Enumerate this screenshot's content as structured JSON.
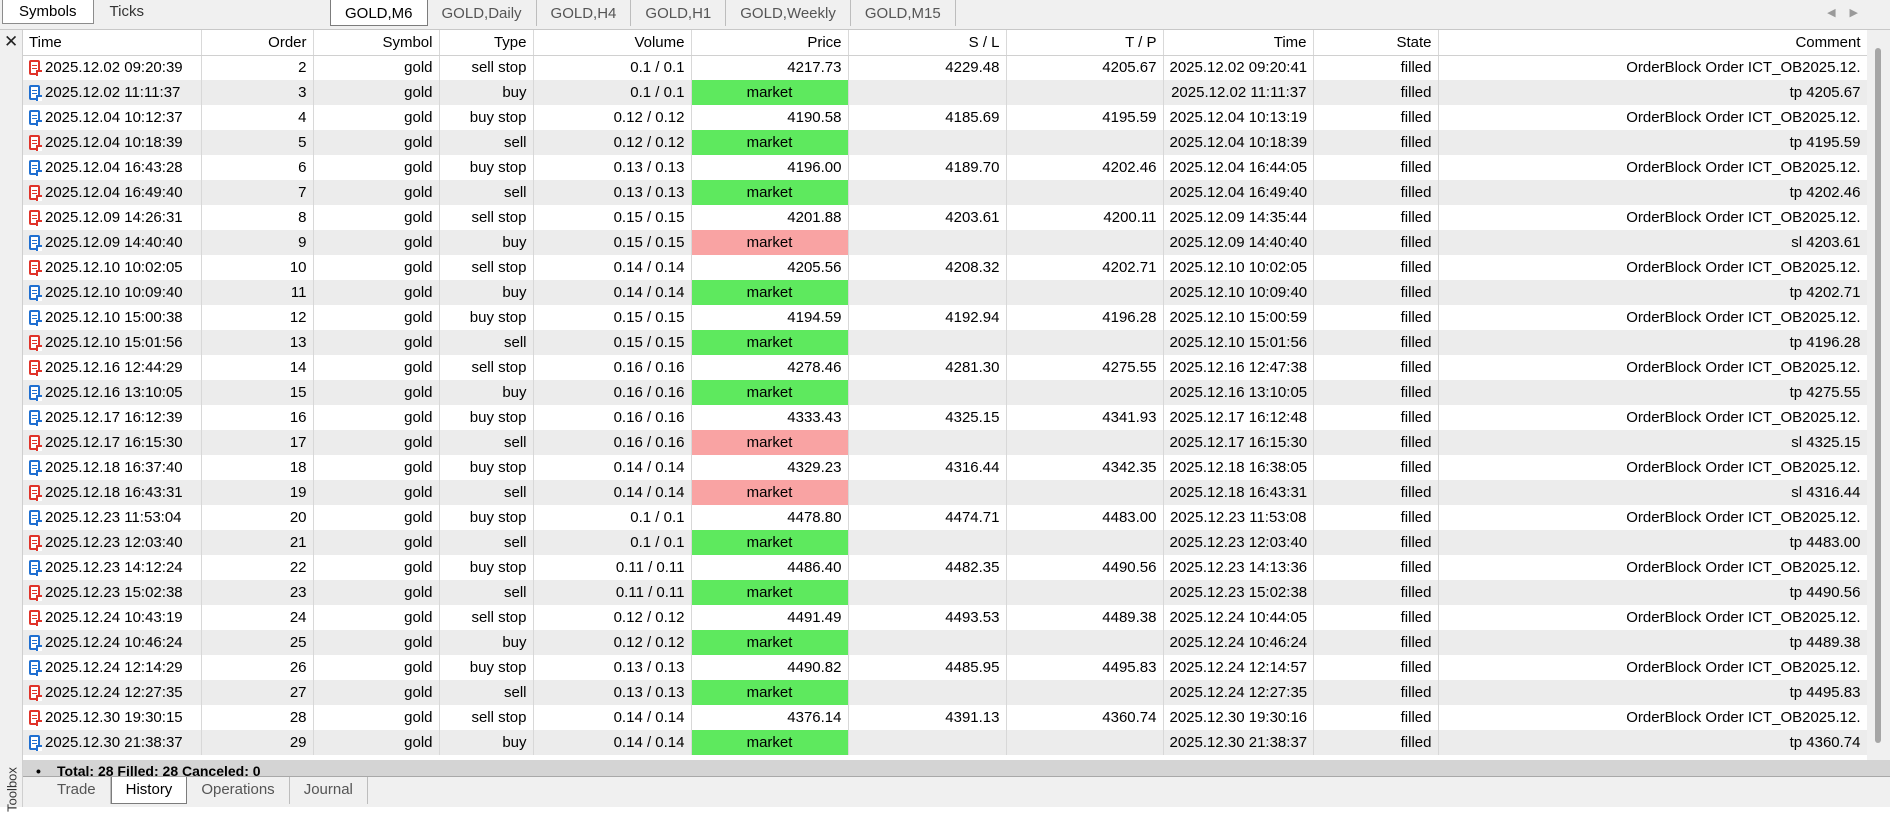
{
  "symbol_tabs": [
    {
      "label": "Symbols",
      "active": true
    },
    {
      "label": "Ticks",
      "active": false
    }
  ],
  "chart_tabs": [
    {
      "label": "GOLD,M6",
      "active": true
    },
    {
      "label": "GOLD,Daily",
      "active": false
    },
    {
      "label": "GOLD,H4",
      "active": false
    },
    {
      "label": "GOLD,H1",
      "active": false
    },
    {
      "label": "GOLD,Weekly",
      "active": false
    },
    {
      "label": "GOLD,M15",
      "active": false
    }
  ],
  "toolbox_label": "Toolbox",
  "columns": [
    "Time",
    "Order",
    "Symbol",
    "Type",
    "Volume",
    "Price",
    "S / L",
    "T / P",
    "Time",
    "State",
    "Comment"
  ],
  "colors": {
    "market_profit": "#5ee95e",
    "market_loss": "#f9a3a3",
    "sell_icon": "#e0332a",
    "buy_icon": "#1f6fd1"
  },
  "orders": [
    {
      "dir": "sell",
      "time": "2025.12.02 09:20:39",
      "order": "2",
      "symbol": "gold",
      "type": "sell stop",
      "volume": "0.1 / 0.1",
      "price": "4217.73",
      "sl": "4229.48",
      "tp": "4205.67",
      "time2": "2025.12.02 09:20:41",
      "state": "filled",
      "comment": "OrderBlock Order ICT_OB2025.12.",
      "mk": ""
    },
    {
      "dir": "buy",
      "time": "2025.12.02 11:11:37",
      "order": "3",
      "symbol": "gold",
      "type": "buy",
      "volume": "0.1 / 0.1",
      "price": "market",
      "sl": "",
      "tp": "",
      "time2": "2025.12.02 11:11:37",
      "state": "filled",
      "comment": "tp 4205.67",
      "mk": "green"
    },
    {
      "dir": "buy",
      "time": "2025.12.04 10:12:37",
      "order": "4",
      "symbol": "gold",
      "type": "buy stop",
      "volume": "0.12 / 0.12",
      "price": "4190.58",
      "sl": "4185.69",
      "tp": "4195.59",
      "time2": "2025.12.04 10:13:19",
      "state": "filled",
      "comment": "OrderBlock Order ICT_OB2025.12.",
      "mk": ""
    },
    {
      "dir": "sell",
      "time": "2025.12.04 10:18:39",
      "order": "5",
      "symbol": "gold",
      "type": "sell",
      "volume": "0.12 / 0.12",
      "price": "market",
      "sl": "",
      "tp": "",
      "time2": "2025.12.04 10:18:39",
      "state": "filled",
      "comment": "tp 4195.59",
      "mk": "green"
    },
    {
      "dir": "buy",
      "time": "2025.12.04 16:43:28",
      "order": "6",
      "symbol": "gold",
      "type": "buy stop",
      "volume": "0.13 / 0.13",
      "price": "4196.00",
      "sl": "4189.70",
      "tp": "4202.46",
      "time2": "2025.12.04 16:44:05",
      "state": "filled",
      "comment": "OrderBlock Order ICT_OB2025.12.",
      "mk": ""
    },
    {
      "dir": "sell",
      "time": "2025.12.04 16:49:40",
      "order": "7",
      "symbol": "gold",
      "type": "sell",
      "volume": "0.13 / 0.13",
      "price": "market",
      "sl": "",
      "tp": "",
      "time2": "2025.12.04 16:49:40",
      "state": "filled",
      "comment": "tp 4202.46",
      "mk": "green"
    },
    {
      "dir": "sell",
      "time": "2025.12.09 14:26:31",
      "order": "8",
      "symbol": "gold",
      "type": "sell stop",
      "volume": "0.15 / 0.15",
      "price": "4201.88",
      "sl": "4203.61",
      "tp": "4200.11",
      "time2": "2025.12.09 14:35:44",
      "state": "filled",
      "comment": "OrderBlock Order ICT_OB2025.12.",
      "mk": ""
    },
    {
      "dir": "buy",
      "time": "2025.12.09 14:40:40",
      "order": "9",
      "symbol": "gold",
      "type": "buy",
      "volume": "0.15 / 0.15",
      "price": "market",
      "sl": "",
      "tp": "",
      "time2": "2025.12.09 14:40:40",
      "state": "filled",
      "comment": "sl 4203.61",
      "mk": "red"
    },
    {
      "dir": "sell",
      "time": "2025.12.10 10:02:05",
      "order": "10",
      "symbol": "gold",
      "type": "sell stop",
      "volume": "0.14 / 0.14",
      "price": "4205.56",
      "sl": "4208.32",
      "tp": "4202.71",
      "time2": "2025.12.10 10:02:05",
      "state": "filled",
      "comment": "OrderBlock Order ICT_OB2025.12.",
      "mk": ""
    },
    {
      "dir": "buy",
      "time": "2025.12.10 10:09:40",
      "order": "11",
      "symbol": "gold",
      "type": "buy",
      "volume": "0.14 / 0.14",
      "price": "market",
      "sl": "",
      "tp": "",
      "time2": "2025.12.10 10:09:40",
      "state": "filled",
      "comment": "tp 4202.71",
      "mk": "green"
    },
    {
      "dir": "buy",
      "time": "2025.12.10 15:00:38",
      "order": "12",
      "symbol": "gold",
      "type": "buy stop",
      "volume": "0.15 / 0.15",
      "price": "4194.59",
      "sl": "4192.94",
      "tp": "4196.28",
      "time2": "2025.12.10 15:00:59",
      "state": "filled",
      "comment": "OrderBlock Order ICT_OB2025.12.",
      "mk": ""
    },
    {
      "dir": "sell",
      "time": "2025.12.10 15:01:56",
      "order": "13",
      "symbol": "gold",
      "type": "sell",
      "volume": "0.15 / 0.15",
      "price": "market",
      "sl": "",
      "tp": "",
      "time2": "2025.12.10 15:01:56",
      "state": "filled",
      "comment": "tp 4196.28",
      "mk": "green"
    },
    {
      "dir": "sell",
      "time": "2025.12.16 12:44:29",
      "order": "14",
      "symbol": "gold",
      "type": "sell stop",
      "volume": "0.16 / 0.16",
      "price": "4278.46",
      "sl": "4281.30",
      "tp": "4275.55",
      "time2": "2025.12.16 12:47:38",
      "state": "filled",
      "comment": "OrderBlock Order ICT_OB2025.12.",
      "mk": ""
    },
    {
      "dir": "buy",
      "time": "2025.12.16 13:10:05",
      "order": "15",
      "symbol": "gold",
      "type": "buy",
      "volume": "0.16 / 0.16",
      "price": "market",
      "sl": "",
      "tp": "",
      "time2": "2025.12.16 13:10:05",
      "state": "filled",
      "comment": "tp 4275.55",
      "mk": "green"
    },
    {
      "dir": "buy",
      "time": "2025.12.17 16:12:39",
      "order": "16",
      "symbol": "gold",
      "type": "buy stop",
      "volume": "0.16 / 0.16",
      "price": "4333.43",
      "sl": "4325.15",
      "tp": "4341.93",
      "time2": "2025.12.17 16:12:48",
      "state": "filled",
      "comment": "OrderBlock Order ICT_OB2025.12.",
      "mk": ""
    },
    {
      "dir": "sell",
      "time": "2025.12.17 16:15:30",
      "order": "17",
      "symbol": "gold",
      "type": "sell",
      "volume": "0.16 / 0.16",
      "price": "market",
      "sl": "",
      "tp": "",
      "time2": "2025.12.17 16:15:30",
      "state": "filled",
      "comment": "sl 4325.15",
      "mk": "red"
    },
    {
      "dir": "buy",
      "time": "2025.12.18 16:37:40",
      "order": "18",
      "symbol": "gold",
      "type": "buy stop",
      "volume": "0.14 / 0.14",
      "price": "4329.23",
      "sl": "4316.44",
      "tp": "4342.35",
      "time2": "2025.12.18 16:38:05",
      "state": "filled",
      "comment": "OrderBlock Order ICT_OB2025.12.",
      "mk": ""
    },
    {
      "dir": "sell",
      "time": "2025.12.18 16:43:31",
      "order": "19",
      "symbol": "gold",
      "type": "sell",
      "volume": "0.14 / 0.14",
      "price": "market",
      "sl": "",
      "tp": "",
      "time2": "2025.12.18 16:43:31",
      "state": "filled",
      "comment": "sl 4316.44",
      "mk": "red"
    },
    {
      "dir": "buy",
      "time": "2025.12.23 11:53:04",
      "order": "20",
      "symbol": "gold",
      "type": "buy stop",
      "volume": "0.1 / 0.1",
      "price": "4478.80",
      "sl": "4474.71",
      "tp": "4483.00",
      "time2": "2025.12.23 11:53:08",
      "state": "filled",
      "comment": "OrderBlock Order ICT_OB2025.12.",
      "mk": ""
    },
    {
      "dir": "sell",
      "time": "2025.12.23 12:03:40",
      "order": "21",
      "symbol": "gold",
      "type": "sell",
      "volume": "0.1 / 0.1",
      "price": "market",
      "sl": "",
      "tp": "",
      "time2": "2025.12.23 12:03:40",
      "state": "filled",
      "comment": "tp 4483.00",
      "mk": "green"
    },
    {
      "dir": "buy",
      "time": "2025.12.23 14:12:24",
      "order": "22",
      "symbol": "gold",
      "type": "buy stop",
      "volume": "0.11 / 0.11",
      "price": "4486.40",
      "sl": "4482.35",
      "tp": "4490.56",
      "time2": "2025.12.23 14:13:36",
      "state": "filled",
      "comment": "OrderBlock Order ICT_OB2025.12.",
      "mk": ""
    },
    {
      "dir": "sell",
      "time": "2025.12.23 15:02:38",
      "order": "23",
      "symbol": "gold",
      "type": "sell",
      "volume": "0.11 / 0.11",
      "price": "market",
      "sl": "",
      "tp": "",
      "time2": "2025.12.23 15:02:38",
      "state": "filled",
      "comment": "tp 4490.56",
      "mk": "green"
    },
    {
      "dir": "sell",
      "time": "2025.12.24 10:43:19",
      "order": "24",
      "symbol": "gold",
      "type": "sell stop",
      "volume": "0.12 / 0.12",
      "price": "4491.49",
      "sl": "4493.53",
      "tp": "4489.38",
      "time2": "2025.12.24 10:44:05",
      "state": "filled",
      "comment": "OrderBlock Order ICT_OB2025.12.",
      "mk": ""
    },
    {
      "dir": "buy",
      "time": "2025.12.24 10:46:24",
      "order": "25",
      "symbol": "gold",
      "type": "buy",
      "volume": "0.12 / 0.12",
      "price": "market",
      "sl": "",
      "tp": "",
      "time2": "2025.12.24 10:46:24",
      "state": "filled",
      "comment": "tp 4489.38",
      "mk": "green"
    },
    {
      "dir": "buy",
      "time": "2025.12.24 12:14:29",
      "order": "26",
      "symbol": "gold",
      "type": "buy stop",
      "volume": "0.13 / 0.13",
      "price": "4490.82",
      "sl": "4485.95",
      "tp": "4495.83",
      "time2": "2025.12.24 12:14:57",
      "state": "filled",
      "comment": "OrderBlock Order ICT_OB2025.12.",
      "mk": ""
    },
    {
      "dir": "sell",
      "time": "2025.12.24 12:27:35",
      "order": "27",
      "symbol": "gold",
      "type": "sell",
      "volume": "0.13 / 0.13",
      "price": "market",
      "sl": "",
      "tp": "",
      "time2": "2025.12.24 12:27:35",
      "state": "filled",
      "comment": "tp 4495.83",
      "mk": "green"
    },
    {
      "dir": "sell",
      "time": "2025.12.30 19:30:15",
      "order": "28",
      "symbol": "gold",
      "type": "sell stop",
      "volume": "0.14 / 0.14",
      "price": "4376.14",
      "sl": "4391.13",
      "tp": "4360.74",
      "time2": "2025.12.30 19:30:16",
      "state": "filled",
      "comment": "OrderBlock Order ICT_OB2025.12.",
      "mk": ""
    },
    {
      "dir": "buy",
      "time": "2025.12.30 21:38:37",
      "order": "29",
      "symbol": "gold",
      "type": "buy",
      "volume": "0.14 / 0.14",
      "price": "market",
      "sl": "",
      "tp": "",
      "time2": "2025.12.30 21:38:37",
      "state": "filled",
      "comment": "tp 4360.74",
      "mk": "green"
    }
  ],
  "summary": {
    "bullet": "•",
    "text": "Total: 28  Filled: 28  Canceled: 0"
  },
  "bottom_tabs": [
    {
      "label": "Trade",
      "active": false
    },
    {
      "label": "History",
      "active": true
    },
    {
      "label": "Operations",
      "active": false
    },
    {
      "label": "Journal",
      "active": false
    }
  ]
}
